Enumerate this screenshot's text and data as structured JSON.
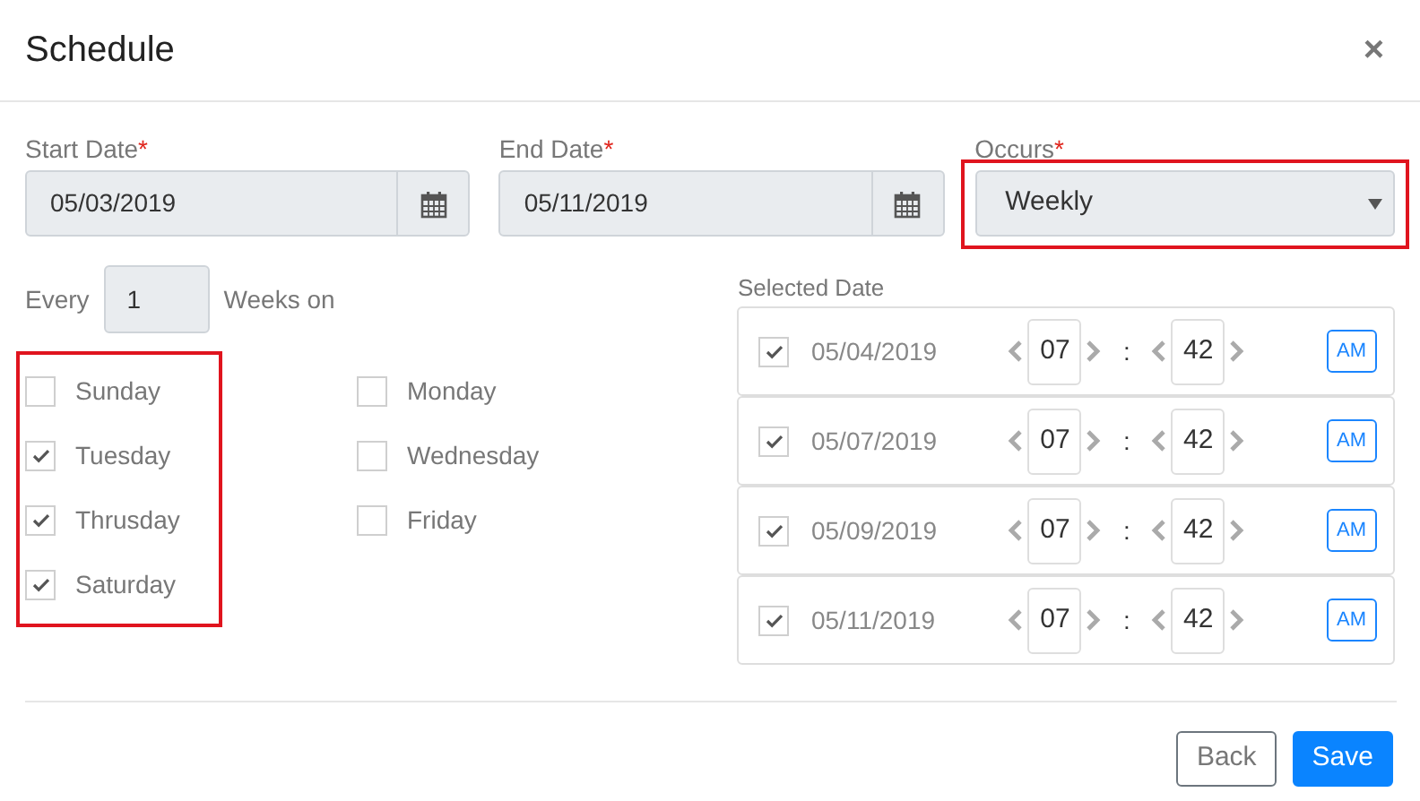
{
  "dialog": {
    "title": "Schedule",
    "close": "×"
  },
  "start_date": {
    "label": "Start Date",
    "required": "*",
    "value": "05/03/2019"
  },
  "end_date": {
    "label": "End Date",
    "required": "*",
    "value": "05/11/2019"
  },
  "occurs": {
    "label": "Occurs",
    "required": "*",
    "value": "Weekly",
    "highlighted": true
  },
  "repeat": {
    "prefix": "Every",
    "value": "1",
    "suffix": "Weeks on"
  },
  "days": {
    "highlighted": true,
    "columns": [
      [
        {
          "label": "Sunday",
          "checked": false
        },
        {
          "label": "Tuesday",
          "checked": true
        },
        {
          "label": "Thrusday",
          "checked": true
        },
        {
          "label": "Saturday",
          "checked": true
        }
      ],
      [
        {
          "label": "Monday",
          "checked": false
        },
        {
          "label": "Wednesday",
          "checked": false
        },
        {
          "label": "Friday",
          "checked": false
        }
      ]
    ]
  },
  "selected_dates": {
    "label": "Selected Date",
    "rows": [
      {
        "date": "05/04/2019",
        "checked": true,
        "hour": "07",
        "separator": ":",
        "minute": "42",
        "period": "AM"
      },
      {
        "date": "05/07/2019",
        "checked": true,
        "hour": "07",
        "separator": ":",
        "minute": "42",
        "period": "AM"
      },
      {
        "date": "05/09/2019",
        "checked": true,
        "hour": "07",
        "separator": ":",
        "minute": "42",
        "period": "AM"
      },
      {
        "date": "05/11/2019",
        "checked": true,
        "hour": "07",
        "separator": ":",
        "minute": "42",
        "period": "AM"
      }
    ]
  },
  "buttons": [
    {
      "label": "Back",
      "kind": "secondary"
    },
    {
      "label": "Save",
      "kind": "primary"
    }
  ]
}
